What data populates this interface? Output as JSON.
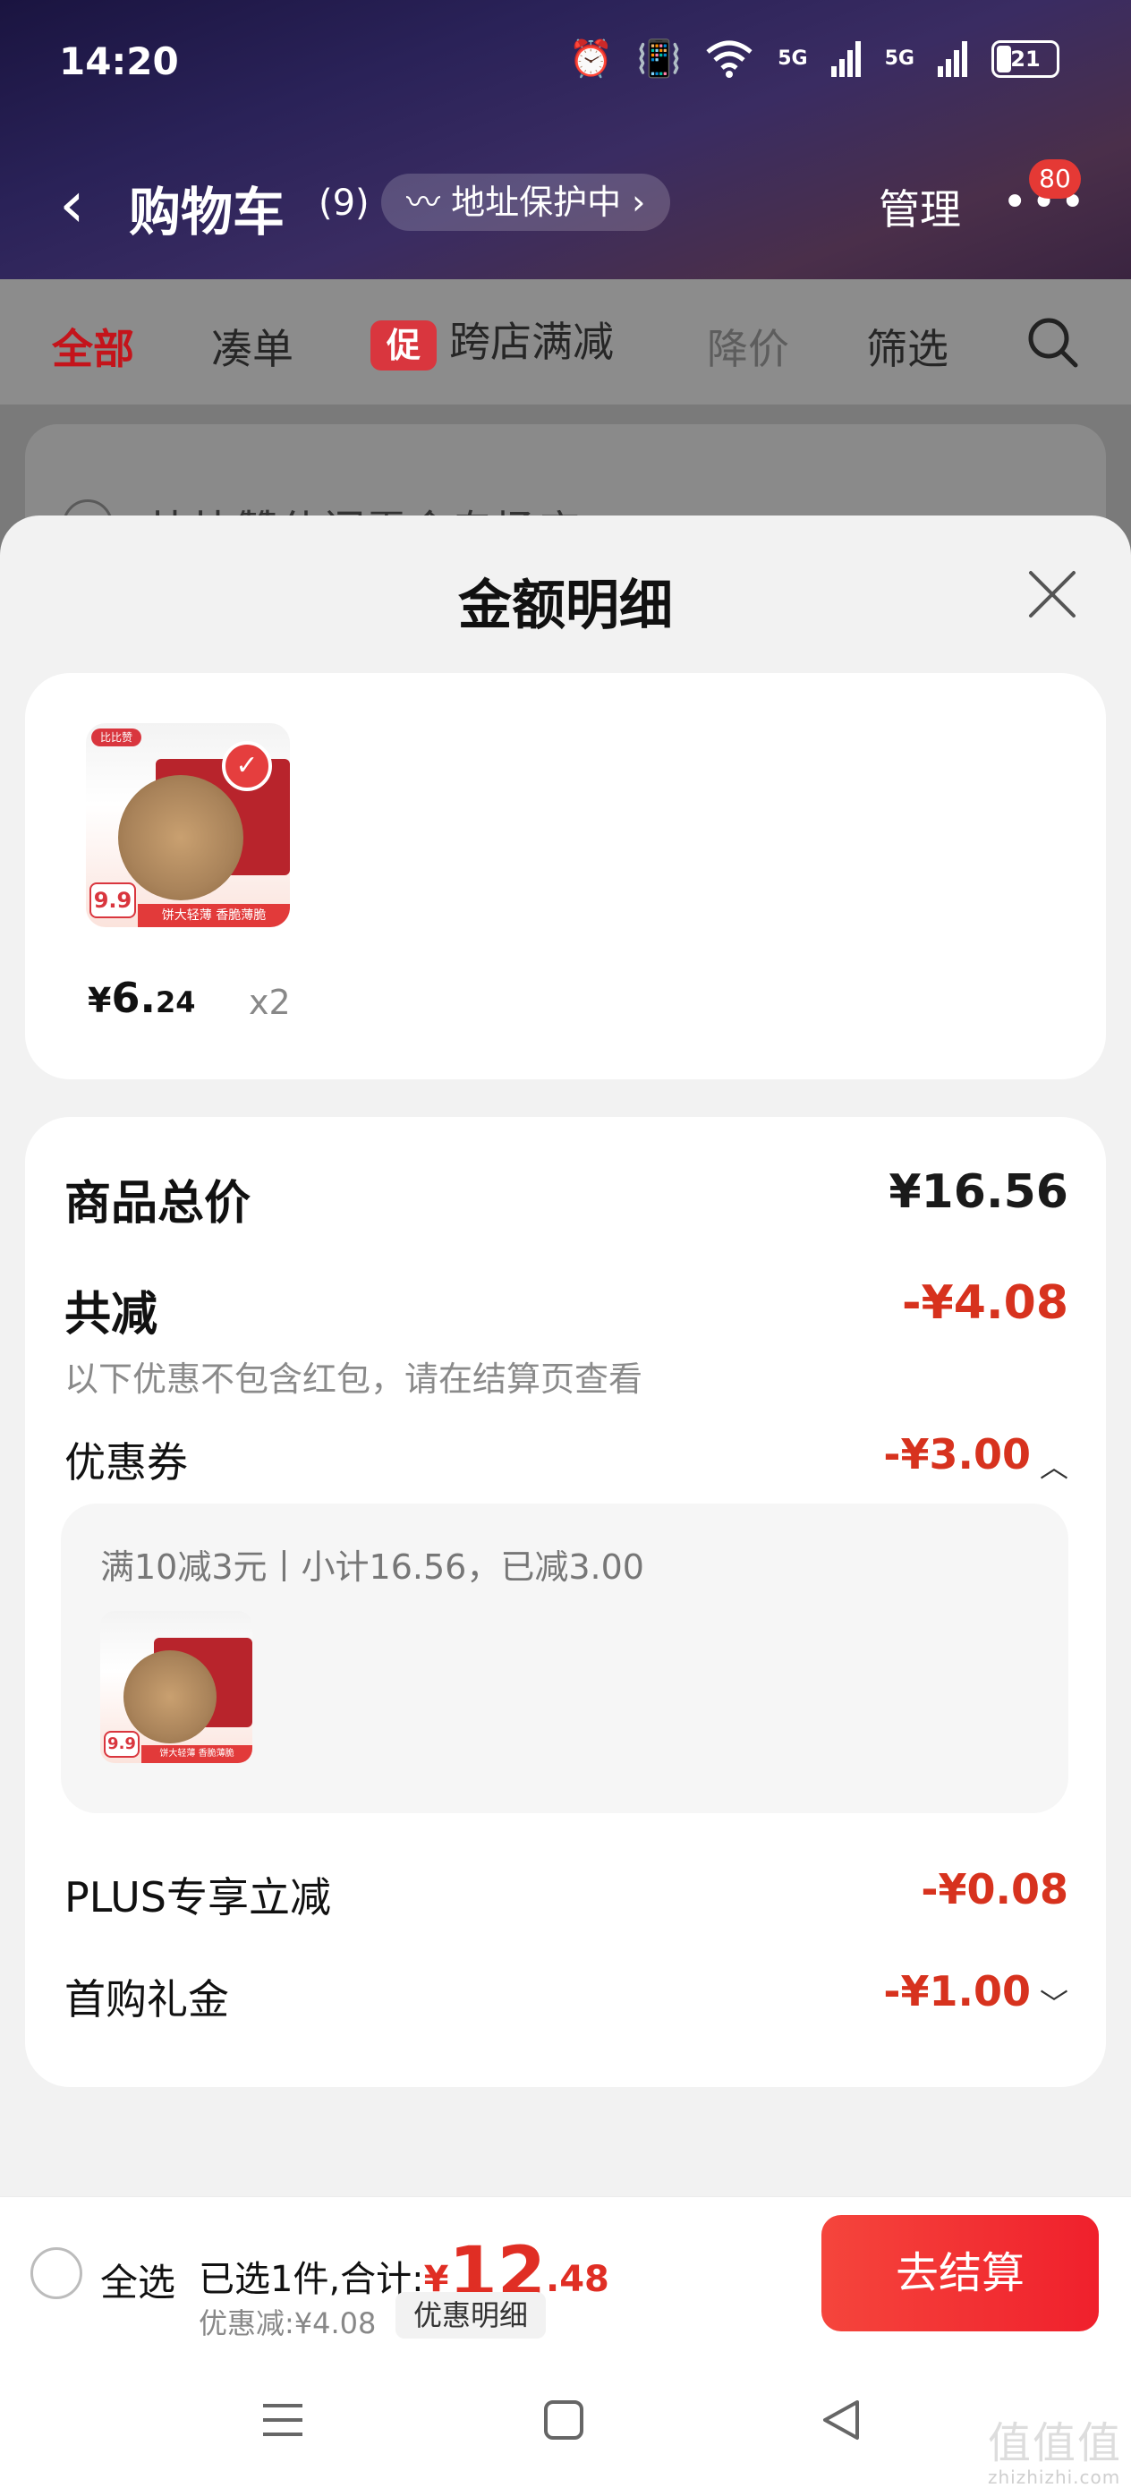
{
  "status_bar": {
    "time": "14:20",
    "battery": "21",
    "signal1": "5G",
    "signal2": "5G"
  },
  "header": {
    "back_glyph": "‹",
    "title": "购物车",
    "count": "(9)",
    "address_protection": "地址保护中 ›",
    "manage": "管理",
    "more_glyph": "•••",
    "badge": "80"
  },
  "filters": {
    "all": "全部",
    "combine": "凑单",
    "promo_tag": "促",
    "cross_store": "跨店满减",
    "price_drop": "降价",
    "filter": "筛选"
  },
  "store_partial": {
    "name": "比比赞休闲零食专场店 ›"
  },
  "sheet": {
    "title": "金额明细",
    "product": {
      "thumb_logo": "比比赞",
      "thumb_price": "9.9",
      "thumb_band": "饼大轻薄 香脆薄脆",
      "price_symbol": "¥",
      "price_int": "6.",
      "price_dec": "24",
      "qty": "x2"
    },
    "total_label": "商品总价",
    "total_value": "¥16.56",
    "discount_label": "共减",
    "discount_value": "-¥4.08",
    "note": "以下优惠不包含红包，请在结算页查看",
    "coupon_label": "优惠券",
    "coupon_value": "-¥3.00",
    "coupon_detail": "满10减3元丨小计16.56，已减3.00",
    "plus_label": "PLUS专享立减",
    "plus_value": "-¥0.08",
    "first_label": "首购礼金",
    "first_value": "-¥1.00"
  },
  "bottom_bar": {
    "select_all": "全选",
    "summary_prefix": "已选1件,合计:",
    "total_symbol": "¥",
    "total_int": "12",
    "total_dec": ".48",
    "discount_text": "优惠减:¥4.08",
    "detail_button": "优惠明细",
    "checkout": "去结算"
  },
  "watermark": {
    "text": "值值值",
    "sub": "zhizhizhi.com"
  },
  "colors": {
    "accent_red": "#e02e24",
    "checkout_red": "#f0202c"
  }
}
